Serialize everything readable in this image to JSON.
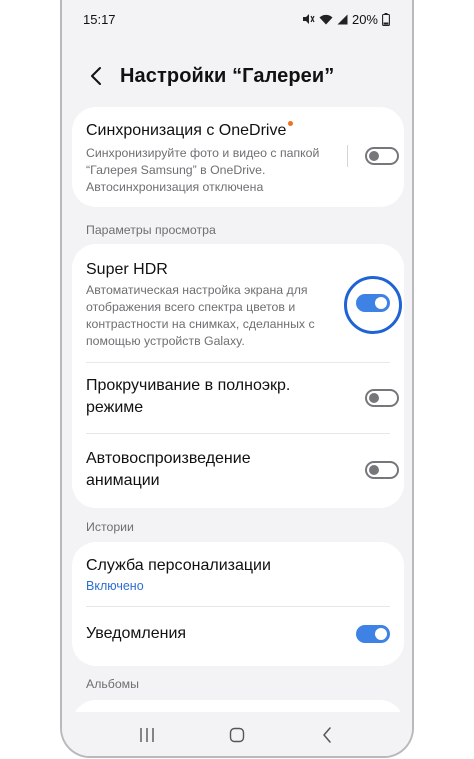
{
  "status_bar": {
    "time": "15:17",
    "battery": "20%",
    "icons": [
      "mute-icon",
      "wifi-icon",
      "signal-icon",
      "battery-icon"
    ]
  },
  "header": {
    "title": "Настройки “Галереи”"
  },
  "onedrive": {
    "title": "Синхронизация с OneDrive",
    "sub_line1": "Синхронизируйте фото и видео с папкой",
    "sub_line2": "“Галерея Samsung” в OneDrive.",
    "sub_line3": "Автосинхронизация отключена",
    "toggle_on": false
  },
  "section_view": "Параметры просмотра",
  "super_hdr": {
    "title": "Super HDR",
    "sub_line1": "Автоматическая настройка экрана для",
    "sub_line2": "отображения всего спектра цветов и",
    "sub_line3": "контрастности на снимках, сделанных с",
    "sub_line4": "помощью устройств Galaxy.",
    "toggle_on": true
  },
  "fullscreen_scroll": {
    "title_line1": "Прокручивание в полноэкр.",
    "title_line2": "режиме",
    "toggle_on": false
  },
  "autoplay": {
    "title_line1": "Автовоспроизведение",
    "title_line2": "анимации",
    "toggle_on": false
  },
  "section_stories": "Истории",
  "personalization": {
    "title": "Служба персонализации",
    "status": "Включено"
  },
  "notifications": {
    "title": "Уведомления",
    "toggle_on": true
  },
  "section_albums": "Альбомы",
  "colors": {
    "accent": "#3e82e5",
    "highlight": "#1f63d4",
    "dot": "#f2711c"
  }
}
